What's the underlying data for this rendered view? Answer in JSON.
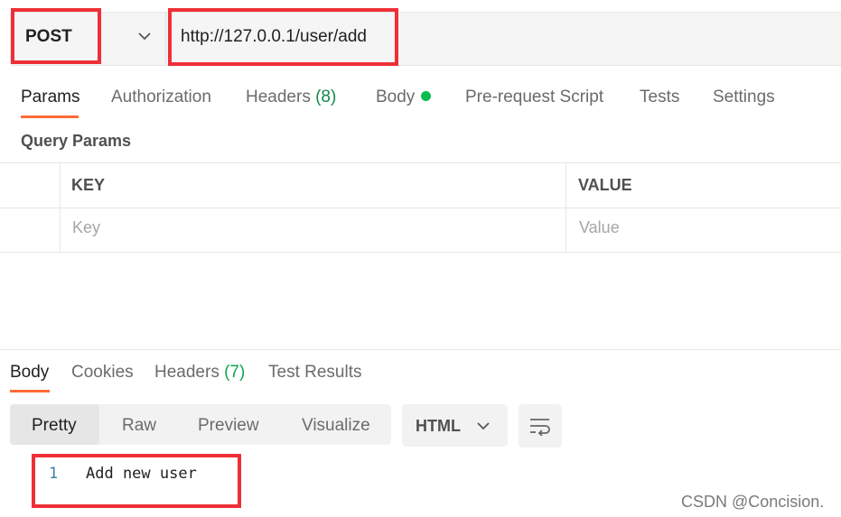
{
  "request": {
    "method": "POST",
    "url": "http://127.0.0.1/user/add"
  },
  "tabs": [
    {
      "label": "Params"
    },
    {
      "label": "Authorization"
    },
    {
      "label": "Headers",
      "count": "(8)"
    },
    {
      "label": "Body"
    },
    {
      "label": "Pre-request Script"
    },
    {
      "label": "Tests"
    },
    {
      "label": "Settings"
    }
  ],
  "query_params": {
    "title": "Query Params",
    "columns": [
      "KEY",
      "VALUE"
    ],
    "placeholders": {
      "key": "Key",
      "value": "Value"
    }
  },
  "response": {
    "tabs": [
      {
        "label": "Body"
      },
      {
        "label": "Cookies"
      },
      {
        "label": "Headers",
        "count": "(7)"
      },
      {
        "label": "Test Results"
      }
    ],
    "view_modes": [
      "Pretty",
      "Raw",
      "Preview",
      "Visualize"
    ],
    "active_view": "Pretty",
    "format": "HTML",
    "code": [
      {
        "line": "1",
        "text": "Add new user"
      }
    ]
  },
  "watermark": "CSDN @Concision.",
  "colors": {
    "accent": "#ff6c37",
    "highlight_box": "#ee2f37",
    "count_green": "#10a54f"
  },
  "icons": {
    "method_dropdown": "chevron-down-icon",
    "body_indicator": "green-dot-icon",
    "format_dropdown": "chevron-down-icon",
    "wrap_button": "text-wrap-icon"
  }
}
